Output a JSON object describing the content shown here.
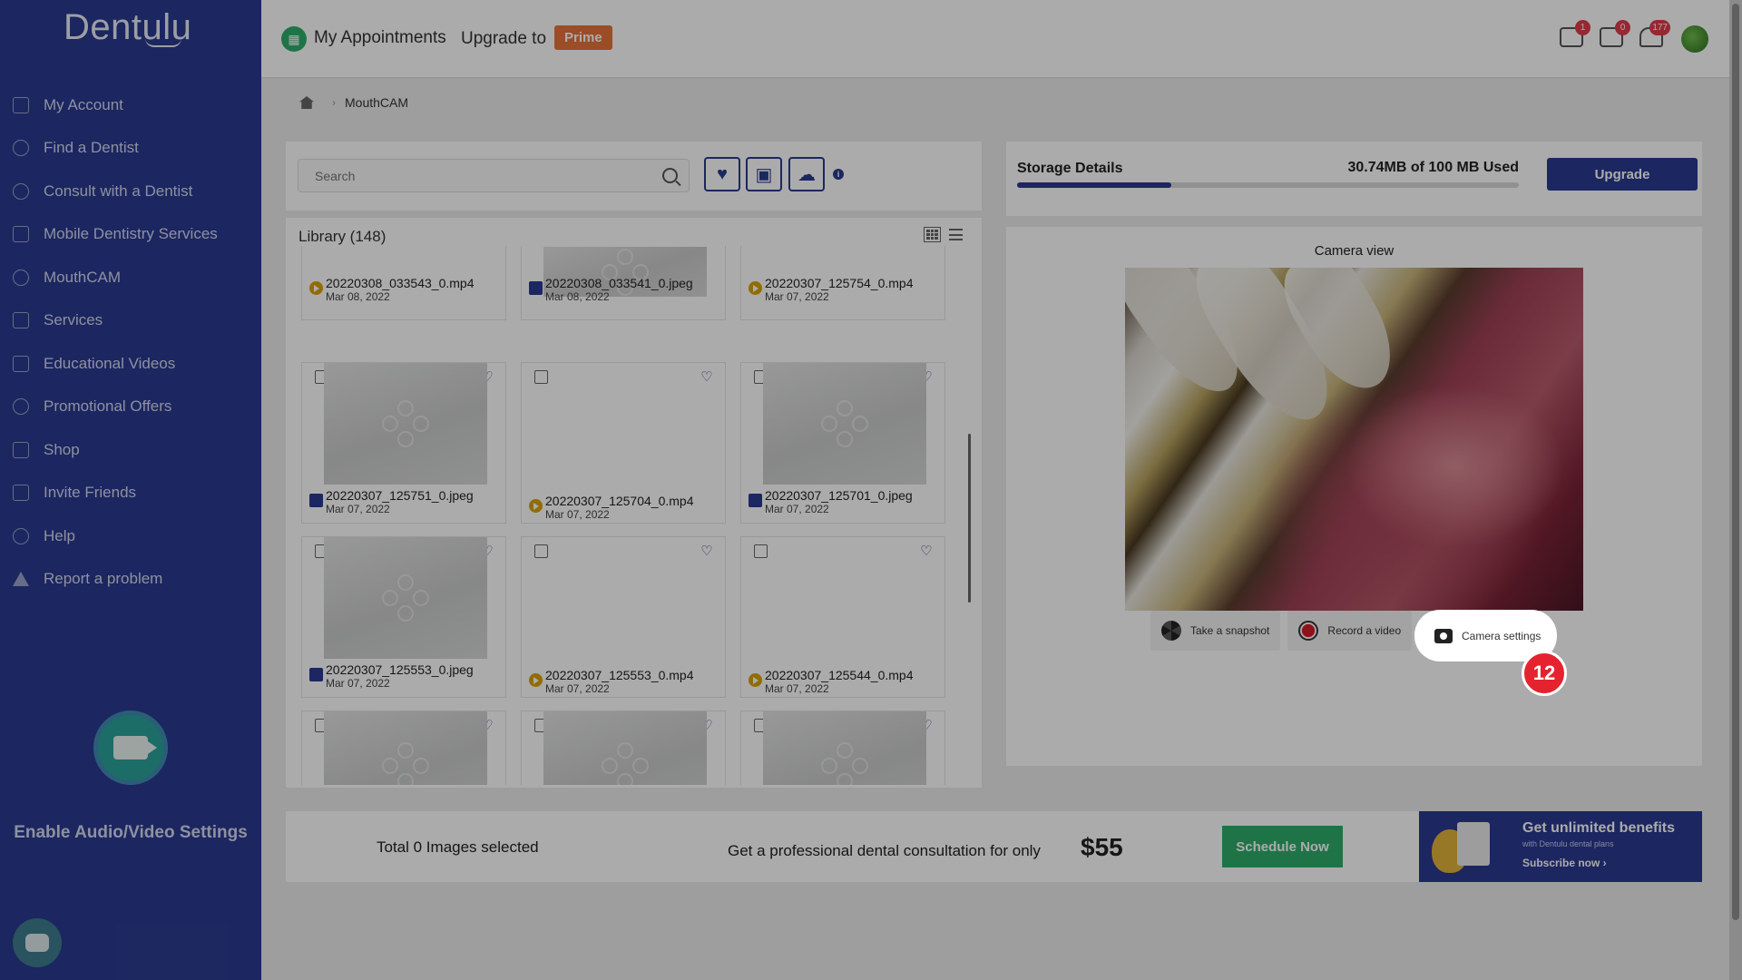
{
  "brand": {
    "logo_text": "Dentulu"
  },
  "sidebar": {
    "items": [
      {
        "label": "My Account",
        "icon": "grid-icon"
      },
      {
        "label": "Find a Dentist",
        "icon": "user-icon"
      },
      {
        "label": "Consult with a Dentist",
        "icon": "consult-icon"
      },
      {
        "label": "Mobile Dentistry Services",
        "icon": "building-icon"
      },
      {
        "label": "MouthCAM",
        "icon": "camera-pen-icon"
      },
      {
        "label": "Services",
        "icon": "services-icon"
      },
      {
        "label": "Educational Videos",
        "icon": "video-icon"
      },
      {
        "label": "Promotional Offers",
        "icon": "gear-icon"
      },
      {
        "label": "Shop",
        "icon": "shop-icon"
      },
      {
        "label": "Invite Friends",
        "icon": "invite-icon"
      },
      {
        "label": "Help",
        "icon": "help-icon"
      },
      {
        "label": "Report a problem",
        "icon": "warning-icon"
      }
    ],
    "av_settings_label": "Enable Audio/Video Settings"
  },
  "header": {
    "appointments_label": "My Appointments",
    "upgrade_text": "Upgrade to",
    "prime_label": "Prime",
    "cart_count": "1",
    "messages_count": "0",
    "notifications_count": "177"
  },
  "breadcrumb": {
    "current": "MouthCAM"
  },
  "toolbar": {
    "search_placeholder": "Search"
  },
  "library": {
    "title": "Library (148)",
    "files": [
      {
        "name": "20220308_033543_0.mp4",
        "date": "Mar 08, 2022",
        "type": "video",
        "thumb": false
      },
      {
        "name": "20220308_033541_0.jpeg",
        "date": "Mar 08, 2022",
        "type": "image",
        "thumb": true
      },
      {
        "name": "20220307_125754_0.mp4",
        "date": "Mar 07, 2022",
        "type": "video",
        "thumb": false
      },
      {
        "name": "20220307_125751_0.jpeg",
        "date": "Mar 07, 2022",
        "type": "image",
        "thumb": true
      },
      {
        "name": "20220307_125704_0.mp4",
        "date": "Mar 07, 2022",
        "type": "video",
        "thumb": false
      },
      {
        "name": "20220307_125701_0.jpeg",
        "date": "Mar 07, 2022",
        "type": "image",
        "thumb": true
      },
      {
        "name": "20220307_125553_0.jpeg",
        "date": "Mar 07, 2022",
        "type": "image",
        "thumb": true
      },
      {
        "name": "20220307_125553_0.mp4",
        "date": "Mar 07, 2022",
        "type": "video",
        "thumb": false
      },
      {
        "name": "20220307_125544_0.mp4",
        "date": "Mar 07, 2022",
        "type": "video",
        "thumb": false
      }
    ]
  },
  "storage": {
    "label": "Storage Details",
    "used_text": "30.74MB of 100 MB Used",
    "used_fraction": 0.3074,
    "upgrade_label": "Upgrade"
  },
  "camera": {
    "title": "Camera view",
    "snapshot_label": "Take a snapshot",
    "record_label": "Record a video",
    "settings_label": "Camera settings"
  },
  "tour": {
    "step_number": "12"
  },
  "bottom": {
    "selected_text": "Total 0 Images selected",
    "promo_text": "Get a professional dental consultation for only",
    "price": "$55",
    "schedule_label": "Schedule Now",
    "benefits_title": "Get unlimited benefits",
    "benefits_sub": "with Dentulu dental plans",
    "benefits_link": "Subscribe now ›"
  },
  "colors": {
    "brand": "#2b3a8f",
    "accent_orange": "#e8743b",
    "green": "#2fae6a",
    "badge_red": "#e23b4a"
  }
}
